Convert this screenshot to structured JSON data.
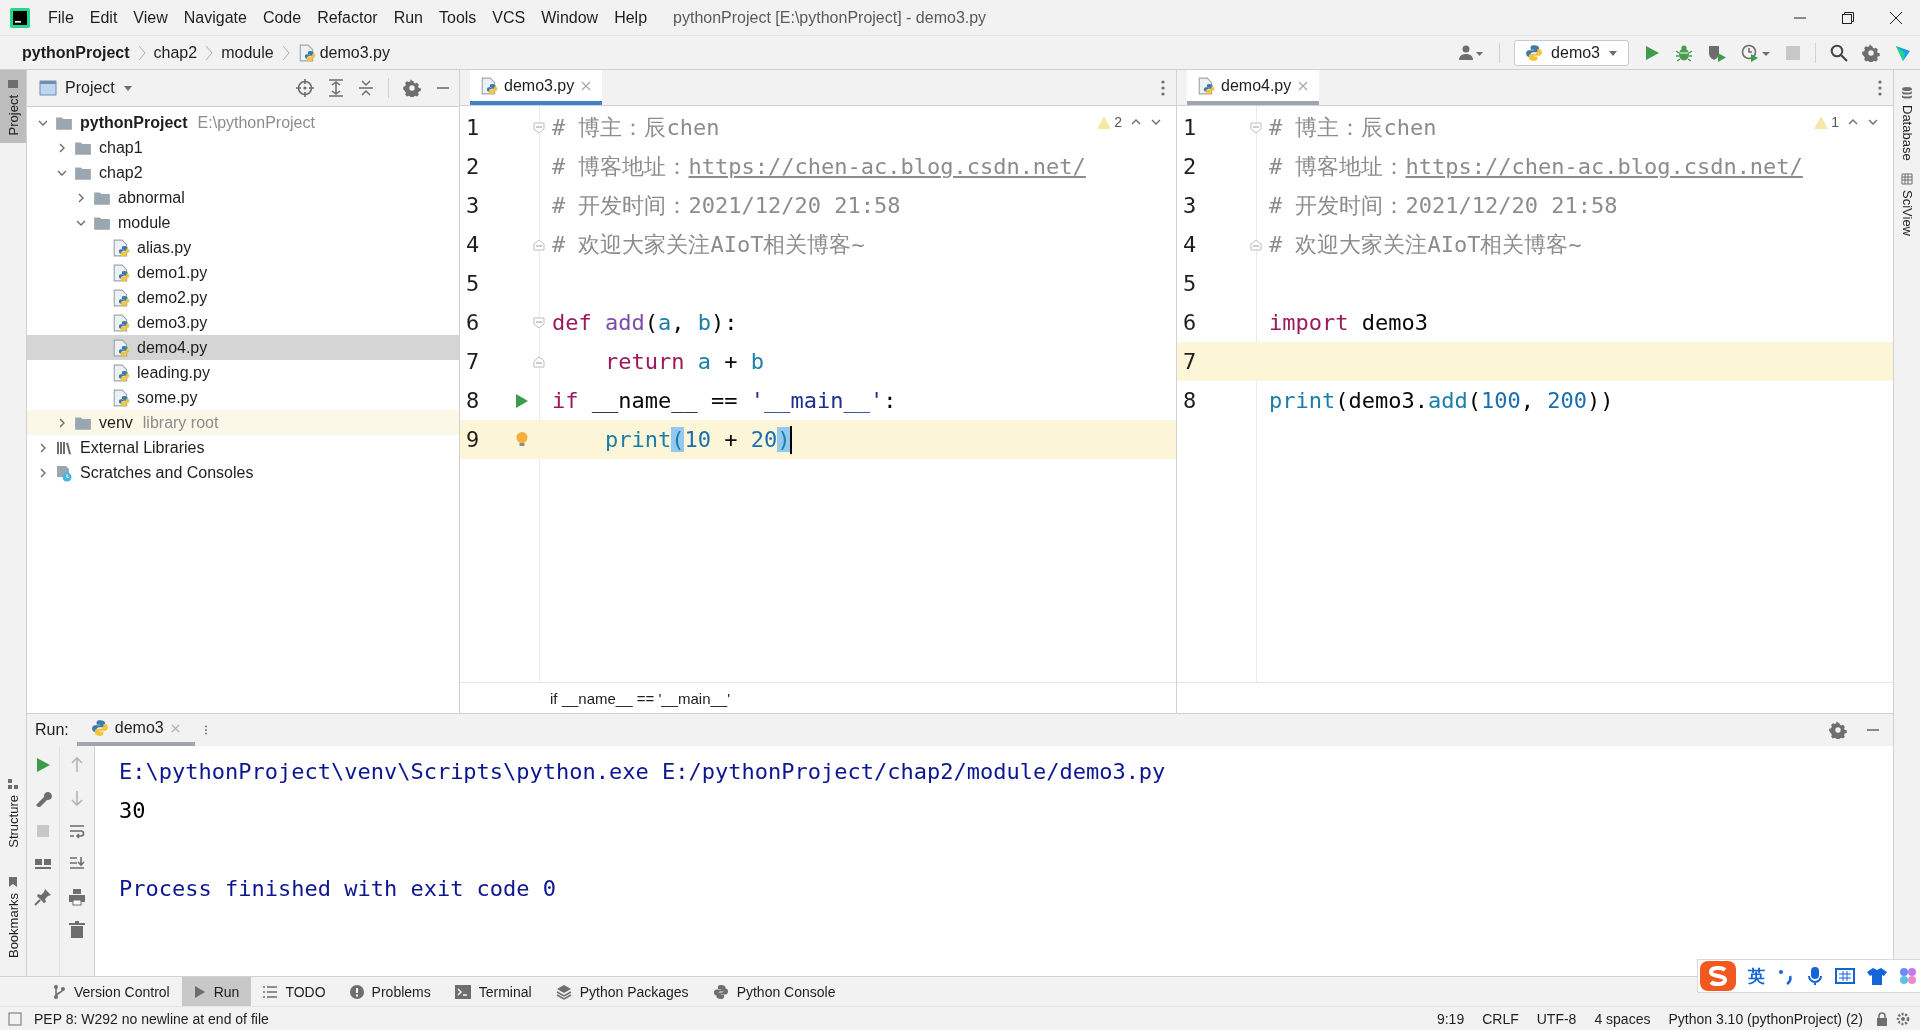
{
  "window": {
    "title": "pythonProject [E:\\pythonProject] - demo3.py"
  },
  "menu": [
    "File",
    "Edit",
    "View",
    "Navigate",
    "Code",
    "Refactor",
    "Run",
    "Tools",
    "VCS",
    "Window",
    "Help"
  ],
  "breadcrumbs": [
    {
      "label": "pythonProject",
      "kind": "project"
    },
    {
      "label": "chap2",
      "kind": "folder"
    },
    {
      "label": "module",
      "kind": "folder"
    },
    {
      "label": "demo3.py",
      "kind": "file"
    }
  ],
  "toolbar": {
    "run_config": "demo3"
  },
  "left_stripe": [
    {
      "label": "Project",
      "selected": true
    },
    {
      "label": "Structure",
      "selected": false
    },
    {
      "label": "Bookmarks",
      "selected": false
    }
  ],
  "right_stripe": [
    {
      "label": "Database"
    },
    {
      "label": "SciView"
    }
  ],
  "project_panel": {
    "title": "Project",
    "tree": [
      {
        "label": "pythonProject",
        "hint": "E:\\pythonProject",
        "kind": "project",
        "expanded": true,
        "selected": false,
        "children": [
          {
            "label": "chap1",
            "kind": "folder",
            "expanded": false,
            "selected": false
          },
          {
            "label": "chap2",
            "kind": "folder",
            "expanded": true,
            "selected": false,
            "children": [
              {
                "label": "abnormal",
                "kind": "folder",
                "expanded": false,
                "selected": false
              },
              {
                "label": "module",
                "kind": "folder",
                "expanded": true,
                "selected": false,
                "children": [
                  {
                    "label": "alias.py",
                    "kind": "file",
                    "selected": false
                  },
                  {
                    "label": "demo1.py",
                    "kind": "file",
                    "selected": false
                  },
                  {
                    "label": "demo2.py",
                    "kind": "file",
                    "selected": false
                  },
                  {
                    "label": "demo3.py",
                    "kind": "file",
                    "selected": false
                  },
                  {
                    "label": "demo4.py",
                    "kind": "file",
                    "selected": true
                  },
                  {
                    "label": "leading.py",
                    "kind": "file",
                    "selected": false
                  },
                  {
                    "label": "some.py",
                    "kind": "file",
                    "selected": false
                  }
                ]
              }
            ]
          },
          {
            "label": "venv",
            "hint": "library root",
            "kind": "venv",
            "expanded": false,
            "selected": false
          }
        ]
      },
      {
        "label": "External Libraries",
        "kind": "libraries",
        "expanded": false,
        "selected": false
      },
      {
        "label": "Scratches and Consoles",
        "kind": "scratches",
        "expanded": false,
        "selected": false
      }
    ]
  },
  "editors": [
    {
      "tab": {
        "label": "demo3.py",
        "selected": true
      },
      "focused": true,
      "warnings": "2",
      "breadcrumb": "if __name__ == '__main__'",
      "lines": [
        {
          "number": "1",
          "highlighted": false,
          "fold_start": true,
          "tokens": [
            {
              "kind": "comment",
              "text": "# 博主：辰chen"
            }
          ]
        },
        {
          "number": "2",
          "highlighted": false,
          "tokens": [
            {
              "kind": "comment",
              "text": "# 博客地址："
            },
            {
              "kind": "link",
              "text": "https://chen-ac.blog.csdn.net/"
            }
          ]
        },
        {
          "number": "3",
          "highlighted": false,
          "tokens": [
            {
              "kind": "comment",
              "text": "# 开发时间：2021/12/20 21:58"
            }
          ]
        },
        {
          "number": "4",
          "highlighted": false,
          "fold_end": true,
          "tokens": [
            {
              "kind": "comment",
              "text": "# 欢迎大家关注AIoT相关博客~"
            }
          ]
        },
        {
          "number": "5",
          "highlighted": false
        },
        {
          "number": "6",
          "highlighted": false,
          "fold_start": true,
          "tokens": [
            {
              "kind": "keyword",
              "text": "def"
            },
            {
              "kind": "function",
              "text": " add"
            },
            {
              "kind": "plain",
              "text": "("
            },
            {
              "kind": "param",
              "text": "a"
            },
            {
              "kind": "plain",
              "text": ", "
            },
            {
              "kind": "param",
              "text": "b"
            },
            {
              "kind": "plain",
              "text": "):"
            }
          ]
        },
        {
          "number": "7",
          "highlighted": false,
          "fold_end": true,
          "tokens": [
            {
              "kind": "keyword",
              "text": "    return"
            },
            {
              "kind": "param",
              "text": " a"
            },
            {
              "kind": "plain",
              "text": " + "
            },
            {
              "kind": "param",
              "text": "b"
            }
          ]
        },
        {
          "number": "8",
          "highlighted": false,
          "run_marker": true,
          "tokens": [
            {
              "kind": "keyword",
              "text": "if"
            },
            {
              "kind": "plain",
              "text": " __name__ == "
            },
            {
              "kind": "string",
              "text": "'__main__'"
            },
            {
              "kind": "plain",
              "text": ":"
            }
          ]
        },
        {
          "number": "9",
          "highlighted": true,
          "intention_bulb": true,
          "caret": true,
          "tokens": [
            {
              "kind": "builtin",
              "text": "    print"
            },
            {
              "kind": "match",
              "text": "("
            },
            {
              "kind": "number",
              "text": "10"
            },
            {
              "kind": "plain",
              "text": " + "
            },
            {
              "kind": "number",
              "text": "20"
            },
            {
              "kind": "match",
              "text": ")"
            }
          ]
        }
      ]
    },
    {
      "tab": {
        "label": "demo4.py",
        "selected": true
      },
      "focused": false,
      "warnings": "1",
      "lines": [
        {
          "number": "1",
          "highlighted": false,
          "fold_start": true,
          "tokens": [
            {
              "kind": "comment",
              "text": "# 博主：辰chen"
            }
          ]
        },
        {
          "number": "2",
          "highlighted": false,
          "tokens": [
            {
              "kind": "comment",
              "text": "# 博客地址："
            },
            {
              "kind": "link",
              "text": "https://chen-ac.blog.csdn.net/"
            }
          ]
        },
        {
          "number": "3",
          "highlighted": false,
          "tokens": [
            {
              "kind": "comment",
              "text": "# 开发时间：2021/12/20 21:58"
            }
          ]
        },
        {
          "number": "4",
          "highlighted": false,
          "fold_end": true,
          "tokens": [
            {
              "kind": "comment",
              "text": "# 欢迎大家关注AIoT相关博客~"
            }
          ]
        },
        {
          "number": "5",
          "highlighted": false
        },
        {
          "number": "6",
          "highlighted": false,
          "tokens": [
            {
              "kind": "keyword",
              "text": "import"
            },
            {
              "kind": "plain",
              "text": " demo3"
            }
          ]
        },
        {
          "number": "7",
          "highlighted": true
        },
        {
          "number": "8",
          "highlighted": false,
          "tokens": [
            {
              "kind": "builtin",
              "text": "print"
            },
            {
              "kind": "plain",
              "text": "(demo3."
            },
            {
              "kind": "builtin",
              "text": "add"
            },
            {
              "kind": "plain",
              "text": "("
            },
            {
              "kind": "number",
              "text": "100"
            },
            {
              "kind": "plain",
              "text": ", "
            },
            {
              "kind": "number",
              "text": "200"
            },
            {
              "kind": "plain",
              "text": "))"
            }
          ]
        }
      ]
    }
  ],
  "run_panel": {
    "label": "Run:",
    "tab": {
      "label": "demo3",
      "selected": true
    },
    "output": [
      {
        "kind": "command",
        "text": "E:\\pythonProject\\venv\\Scripts\\python.exe E:/pythonProject/chap2/module/demo3.py"
      },
      {
        "kind": "stdout",
        "text": "30"
      },
      {
        "kind": "exit",
        "text": "Process finished with exit code 0"
      }
    ]
  },
  "tool_tabs": [
    {
      "label": "Version Control",
      "selected": false
    },
    {
      "label": "Run",
      "selected": true
    },
    {
      "label": "TODO",
      "selected": false
    },
    {
      "label": "Problems",
      "selected": false
    },
    {
      "label": "Terminal",
      "selected": false
    },
    {
      "label": "Python Packages",
      "selected": false
    },
    {
      "label": "Python Console",
      "selected": false
    }
  ],
  "status_bar": {
    "message": "PEP 8: W292 no newline at end of file",
    "items": [
      "9:19",
      "CRLF",
      "UTF-8",
      "4 spaces",
      "Python 3.10 (pythonProject) (2)"
    ]
  },
  "ime_bar": {
    "mode": "英"
  }
}
